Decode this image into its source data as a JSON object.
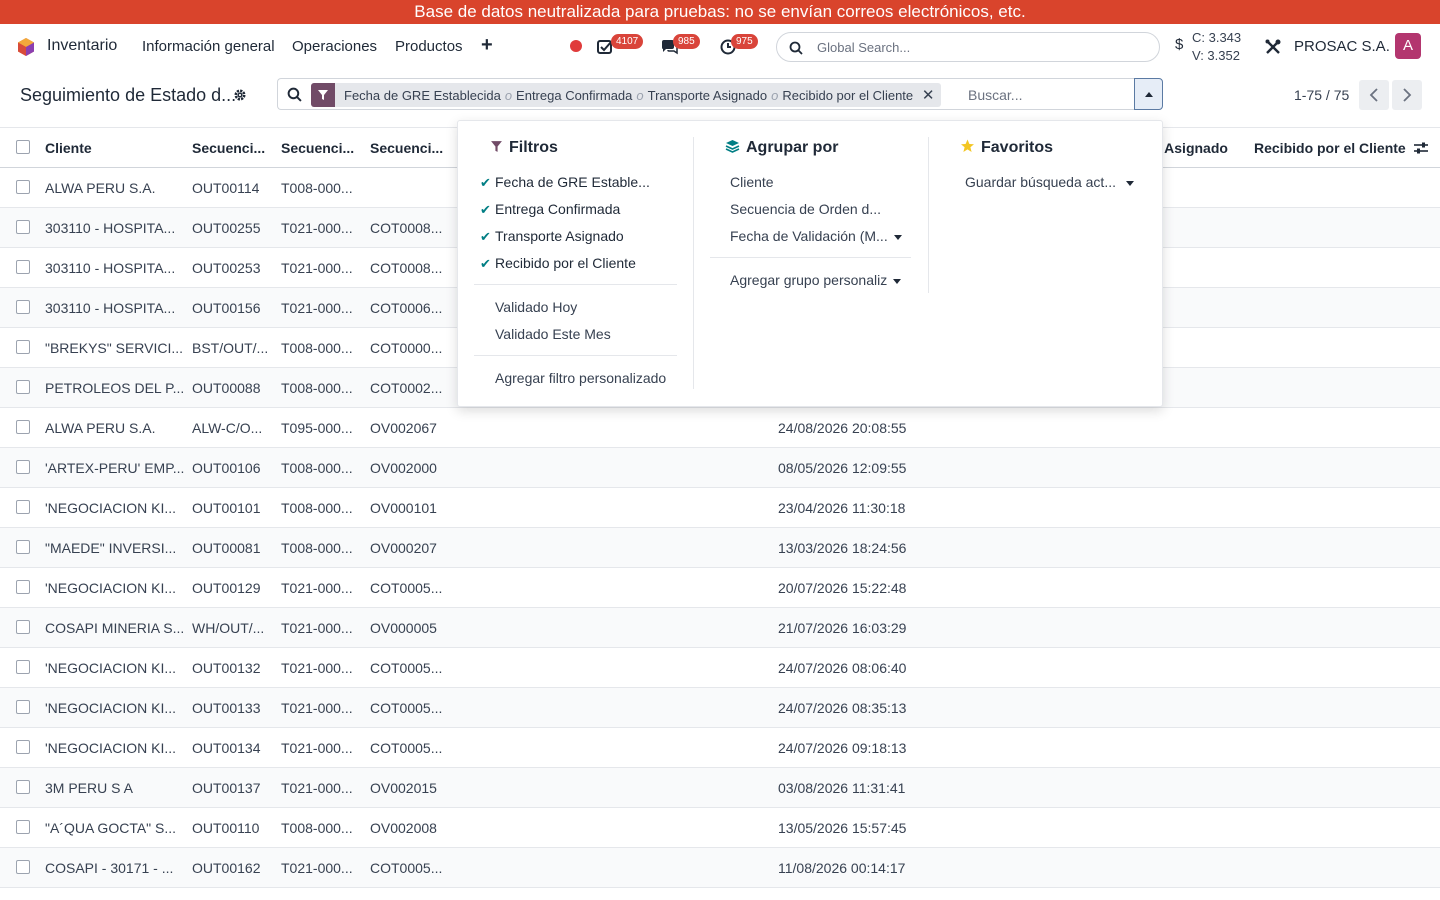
{
  "banner": "Base de datos neutralizada para pruebas: no se envían correos electrónicos, etc.",
  "navbar": {
    "app_name": "Inventario",
    "menu": [
      "Información general",
      "Operaciones",
      "Productos"
    ],
    "badges": {
      "activities": "4107",
      "messages": "985",
      "timers": "975"
    },
    "search_placeholder": "Global Search...",
    "rates_symbol": "$",
    "rate_c": "C: 3.343",
    "rate_v": "V: 3.352",
    "company": "PROSAC S.A.",
    "avatar": "A"
  },
  "control_panel": {
    "title": "Seguimiento de Estado d...",
    "facet_values": [
      "Fecha de GRE Establecida",
      "Entrega Confirmada",
      "Transporte Asignado",
      "Recibido por el Cliente"
    ],
    "facet_separator": "o",
    "search_placeholder": "Buscar...",
    "pager": "1-75 / 75"
  },
  "table": {
    "headers": {
      "cliente": "Cliente",
      "seq1": "Secuenci...",
      "seq2": "Secuenci...",
      "seq3": "Secuenci...",
      "transporte": "e Asignado",
      "recibido": "Recibido por el Cliente"
    },
    "rows": [
      {
        "cliente": "ALWA PERU S.A.",
        "s1": "OUT00114",
        "s2": "T008-000...",
        "s3": "",
        "fecha": ""
      },
      {
        "cliente": "303110 - HOSPITA...",
        "s1": "OUT00255",
        "s2": "T021-000...",
        "s3": "COT0008...",
        "fecha": ""
      },
      {
        "cliente": "303110 - HOSPITA...",
        "s1": "OUT00253",
        "s2": "T021-000...",
        "s3": "COT0008...",
        "fecha": ""
      },
      {
        "cliente": "303110 - HOSPITA...",
        "s1": "OUT00156",
        "s2": "T021-000...",
        "s3": "COT0006...",
        "fecha": ""
      },
      {
        "cliente": "\"BREKYS\" SERVICI...",
        "s1": "BST/OUT/...",
        "s2": "T008-000...",
        "s3": "COT0000...",
        "fecha": ""
      },
      {
        "cliente": "PETROLEOS DEL P...",
        "s1": "OUT00088",
        "s2": "T008-000...",
        "s3": "COT0002...",
        "fecha": ""
      },
      {
        "cliente": "ALWA PERU S.A.",
        "s1": "ALW-C/O...",
        "s2": "T095-000...",
        "s3": "OV002067",
        "fecha": "24/08/2026 20:08:55"
      },
      {
        "cliente": "'ARTEX-PERU' EMP...",
        "s1": "OUT00106",
        "s2": "T008-000...",
        "s3": "OV002000",
        "fecha": "08/05/2026 12:09:55"
      },
      {
        "cliente": "'NEGOCIACION KI...",
        "s1": "OUT00101",
        "s2": "T008-000...",
        "s3": "OV000101",
        "fecha": "23/04/2026 11:30:18"
      },
      {
        "cliente": "\"MAEDE\" INVERSI...",
        "s1": "OUT00081",
        "s2": "T008-000...",
        "s3": "OV000207",
        "fecha": "13/03/2026 18:24:56"
      },
      {
        "cliente": "'NEGOCIACION KI...",
        "s1": "OUT00129",
        "s2": "T021-000...",
        "s3": "COT0005...",
        "fecha": "20/07/2026 15:22:48"
      },
      {
        "cliente": "COSAPI MINERIA S...",
        "s1": "WH/OUT/...",
        "s2": "T021-000...",
        "s3": "OV000005",
        "fecha": "21/07/2026 16:03:29"
      },
      {
        "cliente": "'NEGOCIACION KI...",
        "s1": "OUT00132",
        "s2": "T021-000...",
        "s3": "COT0005...",
        "fecha": "24/07/2026 08:06:40"
      },
      {
        "cliente": "'NEGOCIACION KI...",
        "s1": "OUT00133",
        "s2": "T021-000...",
        "s3": "COT0005...",
        "fecha": "24/07/2026 08:35:13"
      },
      {
        "cliente": "'NEGOCIACION KI...",
        "s1": "OUT00134",
        "s2": "T021-000...",
        "s3": "COT0005...",
        "fecha": "24/07/2026 09:18:13"
      },
      {
        "cliente": "3M PERU S A",
        "s1": "OUT00137",
        "s2": "T021-000...",
        "s3": "OV002015",
        "fecha": "03/08/2026 11:31:41"
      },
      {
        "cliente": "\"A´QUA GOCTA\" S...",
        "s1": "OUT00110",
        "s2": "T008-000...",
        "s3": "OV002008",
        "fecha": "13/05/2026 15:57:45"
      },
      {
        "cliente": "COSAPI - 30171 - ...",
        "s1": "OUT00162",
        "s2": "T021-000...",
        "s3": "COT0005...",
        "fecha": "11/08/2026 00:14:17"
      }
    ]
  },
  "dropdown": {
    "filters": {
      "title": "Filtros",
      "checked_items": [
        "Fecha de GRE Estable...",
        "Entrega Confirmada",
        "Transporte Asignado",
        "Recibido por el Cliente"
      ],
      "date_items": [
        "Validado Hoy",
        "Validado Este Mes"
      ],
      "custom": "Agregar filtro personalizado"
    },
    "group_by": {
      "title": "Agrupar por",
      "items": [
        "Cliente",
        "Secuencia de Orden d...",
        "Fecha de Validación (M..."
      ],
      "custom": "Agregar grupo personaliz"
    },
    "favorites": {
      "title": "Favoritos",
      "save": "Guardar búsqueda act..."
    }
  },
  "colors": {
    "banner": "#d9442c",
    "primary": "#714b67",
    "badge": "#d9443a",
    "check": "#017e84",
    "avatar": "#b3366f"
  }
}
